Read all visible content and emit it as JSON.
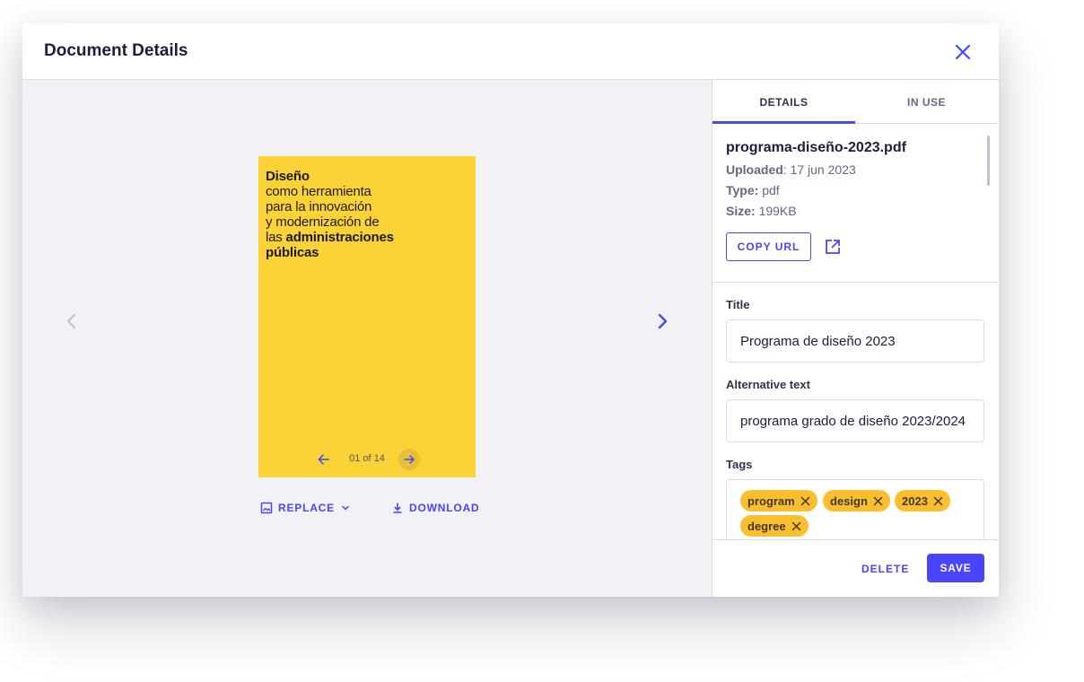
{
  "header": {
    "title": "Document Details",
    "close_icon": "close-icon"
  },
  "preview": {
    "document": {
      "line1_bold": "Diseño",
      "line2": "como herramienta",
      "line3": "para la innovación",
      "line4": "y modernización de",
      "line5_prefix": "las",
      "line5_bold": "administraciones",
      "line6_bold": "públicas",
      "background": "#fbd336"
    },
    "pager": {
      "text": "01 of 14"
    },
    "actions": {
      "replace_label": "REPLACE",
      "download_label": "DOWNLOAD"
    }
  },
  "tabs": [
    {
      "label": "DETAILS",
      "active": true
    },
    {
      "label": "IN USE",
      "active": false
    }
  ],
  "file": {
    "name": "programa-diseño-2023.pdf",
    "uploaded_key": "Uploaded",
    "uploaded_value": ": 17 jun 2023",
    "type_key": "Type:",
    "type_value": " pdf",
    "size_key": "Size:",
    "size_value": " 199KB",
    "copy_url_label": "COPY URL"
  },
  "form": {
    "title_label": "Title",
    "title_value": "Programa de diseño 2023",
    "alt_label": "Alternative text",
    "alt_value": "programa grado de diseño 2023/2024",
    "tags_label": "Tags",
    "tags": [
      "program",
      "design",
      "2023",
      "degree"
    ]
  },
  "footer": {
    "delete_label": "DELETE",
    "save_label": "SAVE"
  },
  "colors": {
    "accent": "#4945ff",
    "tag": "#fbbe2e",
    "preview_bg": "#f1f1f6"
  }
}
